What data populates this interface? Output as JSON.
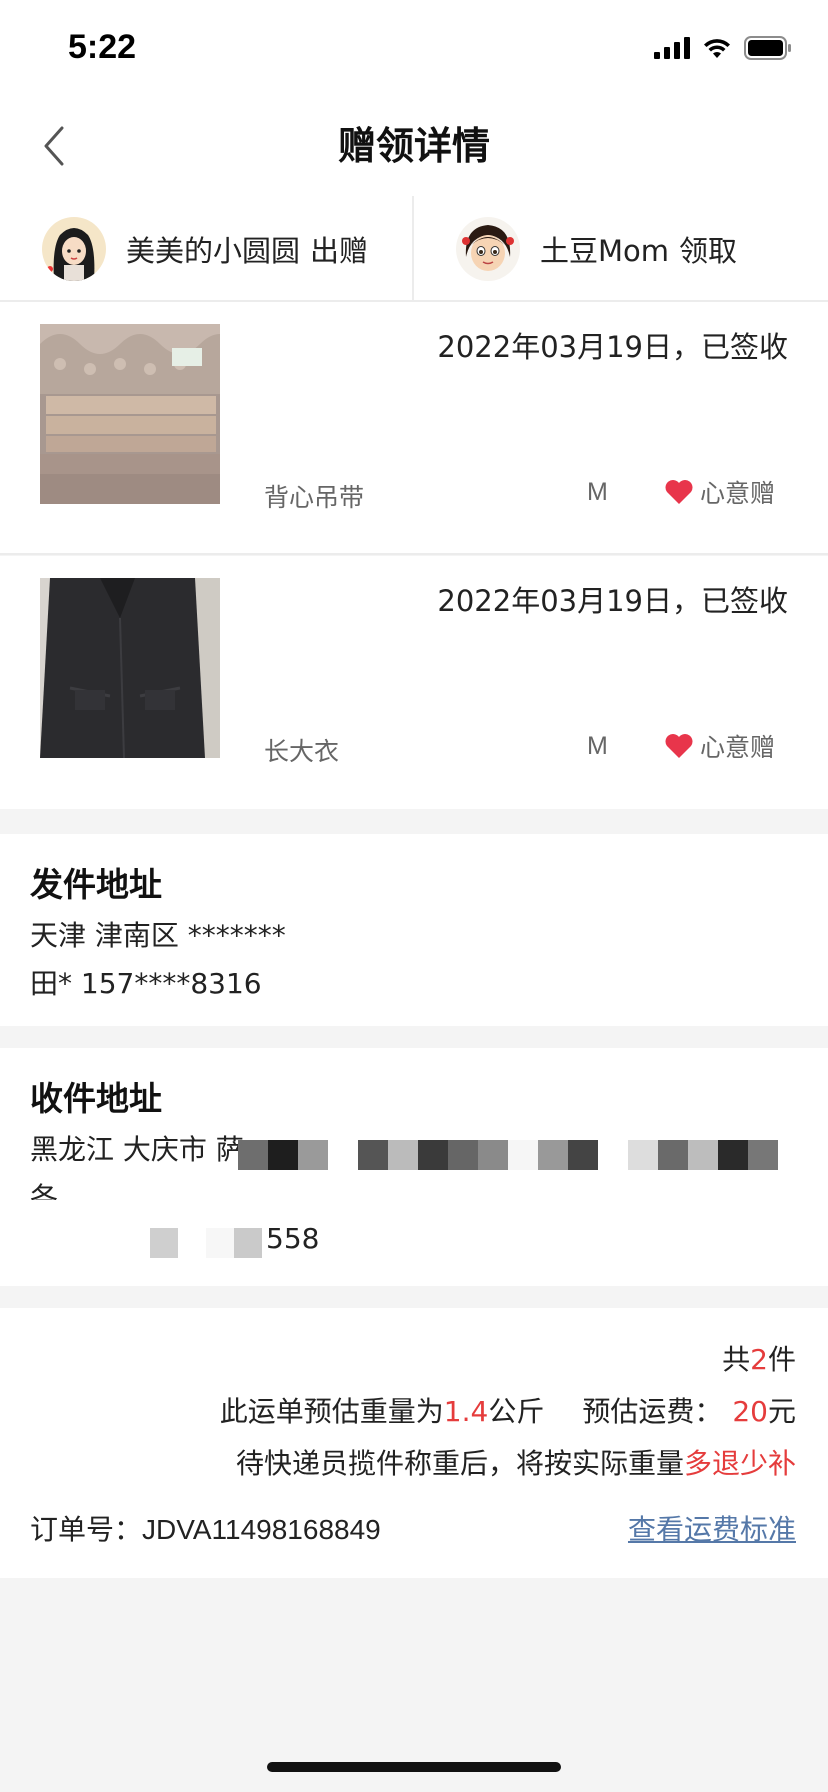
{
  "status_bar": {
    "time": "5:22"
  },
  "nav": {
    "title": "赠领详情"
  },
  "parties": {
    "giver": {
      "name": "美美的小圆圆",
      "role": "出赠"
    },
    "receiver": {
      "name": "土豆Mom",
      "role": "领取"
    }
  },
  "items": [
    {
      "date_status": "2022年03月19日，已签收",
      "name": "背心吊带",
      "size": "M",
      "type": "心意赠"
    },
    {
      "date_status": "2022年03月19日，已签收",
      "name": "长大衣",
      "size": "M",
      "type": "心意赠"
    }
  ],
  "sender": {
    "title": "发件地址",
    "address": "天津 津南区 *******",
    "contact": "田* 157****8316"
  },
  "receiver_addr": {
    "title": "收件地址",
    "address_visible": "黑龙江 大庆市 萨",
    "line2_visible": "各",
    "contact_visible": "558"
  },
  "summary": {
    "count_prefix": "共",
    "count": "2",
    "count_suffix": "件",
    "weight_prefix": "此运单预估重量为",
    "weight": "1.4",
    "weight_unit": "公斤",
    "fee_label": "预估运费：",
    "fee": "20",
    "fee_unit": "元",
    "note_prefix": "待快递员揽件称重后，将按实际重量",
    "note_highlight": "多退少补",
    "order_label": "订单号：",
    "order_no": "JDVA11498168849",
    "fee_standard_link": "查看运费标准"
  },
  "colors": {
    "accent_red": "#e53c3c",
    "link_blue": "#5578a8",
    "heart": "#e8354b"
  }
}
